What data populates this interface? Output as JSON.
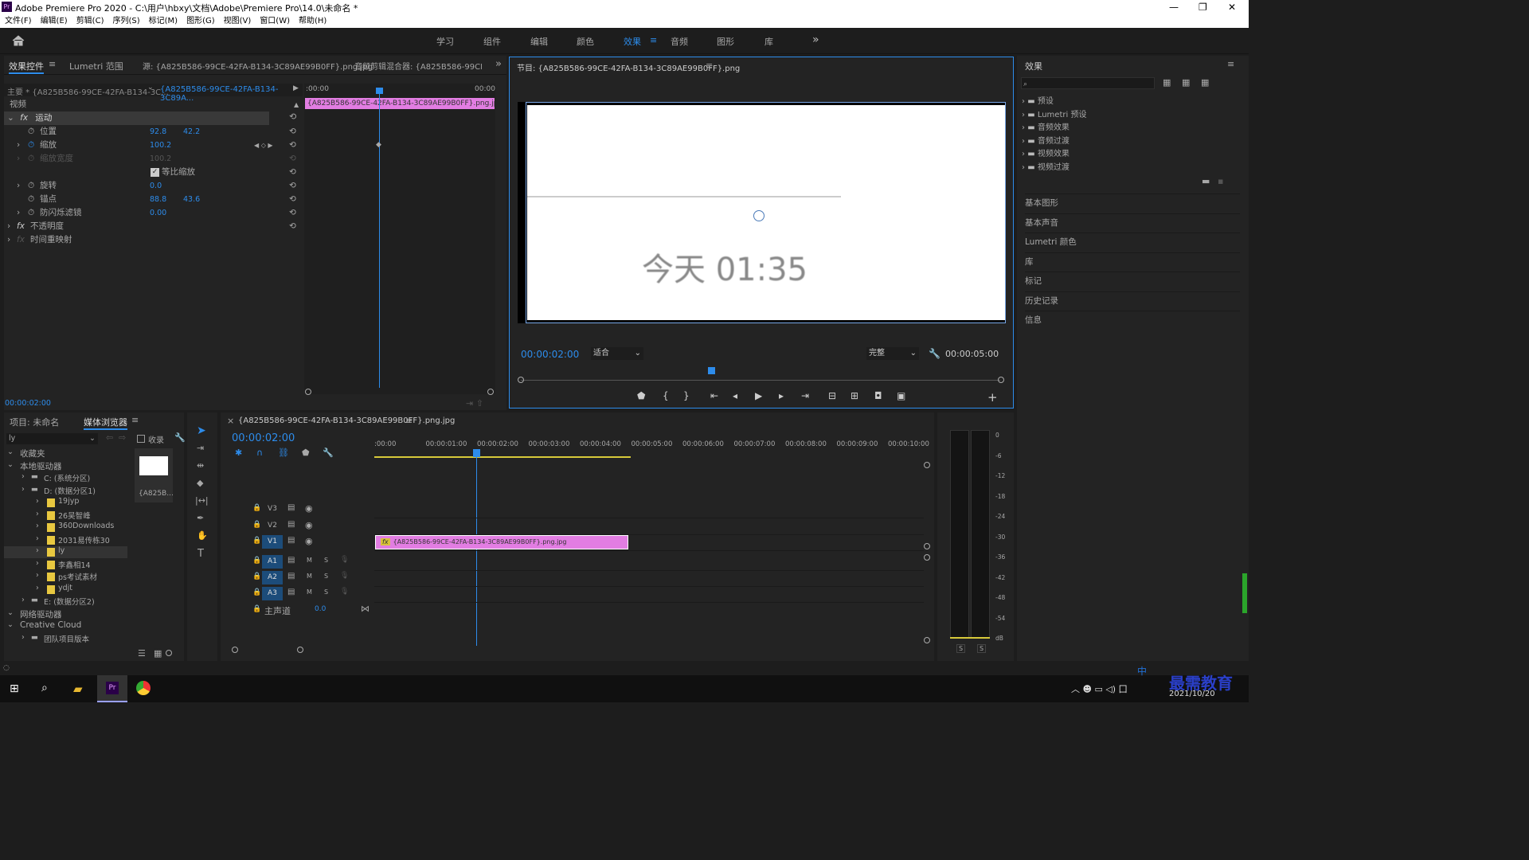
{
  "window": {
    "app_icon": "Pr",
    "title": "Adobe Premiere Pro 2020 - C:\\用户\\hbxy\\文档\\Adobe\\Premiere Pro\\14.0\\未命名 *",
    "minimize": "—",
    "maximize": "❐",
    "close": "✕"
  },
  "menu": [
    "文件(F)",
    "编辑(E)",
    "剪辑(C)",
    "序列(S)",
    "标记(M)",
    "图形(G)",
    "视图(V)",
    "窗口(W)",
    "帮助(H)"
  ],
  "workspaces": [
    "学习",
    "组件",
    "编辑",
    "颜色",
    "效果",
    "音频",
    "图形",
    "库"
  ],
  "workspace_active": "效果",
  "effect_controls": {
    "tabs": [
      "效果控件",
      "Lumetri 范围",
      "源: {A825B586-99CE-42FA-B134-3C89AE99B0FF}.png.jpg",
      "音频剪辑混合器: {A825B586-99CE-4"
    ],
    "master": "主要 * {A825B586-99CE-42FA-B134-3C...",
    "clip": "{A825B586-99CE-42FA-B134-3C89A...",
    "section_video": "视频",
    "fx": "fx",
    "motion": "运动",
    "position": "位置",
    "position_x": "92.8",
    "position_y": "42.2",
    "scale": "缩放",
    "scale_v": "100.2",
    "scale_width": "缩放宽度",
    "scale_width_v": "100.2",
    "uniform": "等比缩放",
    "rotation": "旋转",
    "rotation_v": "0.0",
    "anchor": "锚点",
    "anchor_x": "88.8",
    "anchor_y": "43.6",
    "antiflicker": "防闪烁滤镜",
    "antiflicker_v": "0.00",
    "opacity": "不透明度",
    "time_remap": "时间重映射",
    "t_start": ":00:00",
    "t_end": "00:00",
    "clip_label": "{A825B586-99CE-42FA-B134-3C89AE99B0FF}.png.jpg",
    "timecode": "00:00:02:00"
  },
  "program": {
    "title": "节目: {A825B586-99CE-42FA-B134-3C89AE99B0FF}.png",
    "text": "今天 01:35",
    "timecode": "00:00:02:00",
    "fit": "适合",
    "quality": "完整",
    "duration": "00:00:05:00"
  },
  "effects_panel": {
    "title": "效果",
    "items": [
      "预设",
      "Lumetri 预设",
      "音频效果",
      "音频过渡",
      "视频效果",
      "视频过渡"
    ],
    "sections": [
      "基本图形",
      "基本声音",
      "Lumetri 颜色",
      "库",
      "标记",
      "历史记录",
      "信息"
    ]
  },
  "project": {
    "tabs": [
      "项目: 未命名",
      "媒体浏览器"
    ],
    "path": "ly",
    "favorites_chk": "收录",
    "tree": [
      {
        "t": "收藏夹",
        "d": 0
      },
      {
        "t": "本地驱动器",
        "d": 0
      },
      {
        "t": "C: (系统分区)",
        "d": 1
      },
      {
        "t": "D: (数据分区1)",
        "d": 1
      },
      {
        "t": "19jyp",
        "d": 2
      },
      {
        "t": "26吴智峰",
        "d": 2
      },
      {
        "t": "360Downloads",
        "d": 2
      },
      {
        "t": "2031易传栋30",
        "d": 2
      },
      {
        "t": "ly",
        "d": 2
      },
      {
        "t": "李鑫相14",
        "d": 2
      },
      {
        "t": "ps考试素材",
        "d": 2
      },
      {
        "t": "ydjt",
        "d": 2
      },
      {
        "t": "E: (数据分区2)",
        "d": 1
      },
      {
        "t": "网络驱动器",
        "d": 0
      },
      {
        "t": "Creative Cloud",
        "d": 0
      },
      {
        "t": "团队项目版本",
        "d": 1
      }
    ],
    "thumb": "{A825B..."
  },
  "timeline": {
    "title": "{A825B586-99CE-42FA-B134-3C89AE99B0FF}.png.jpg",
    "close": "×",
    "timecode": "00:00:02:00",
    "ruler": [
      ":00:00",
      "00:00:01:00",
      "00:00:02:00",
      "00:00:03:00",
      "00:00:04:00",
      "00:00:05:00",
      "00:00:06:00",
      "00:00:07:00",
      "00:00:08:00",
      "00:00:09:00",
      "00:00:10:00",
      "0"
    ],
    "tracks_v": [
      "V3",
      "V2",
      "V1"
    ],
    "tracks_a": [
      "A1",
      "A2",
      "A3"
    ],
    "m": "M",
    "s": "S",
    "master": "主声道",
    "master_v": "0.0",
    "clip": "{A825B586-99CE-42FA-B134-3C89AE99B0FF}.png.jpg"
  },
  "meter": {
    "scale": [
      "0",
      "-6",
      "-12",
      "-18",
      "-24",
      "-30",
      "-36",
      "-42",
      "-48",
      "-54",
      "dB"
    ],
    "s": "S"
  },
  "taskbar": {
    "date": "2021/10/20",
    "ime": "中",
    "brand": "最需教育"
  },
  "colors": {
    "accent": "#2d8ceb",
    "clip": "#e27de2",
    "bg": "#232323"
  }
}
